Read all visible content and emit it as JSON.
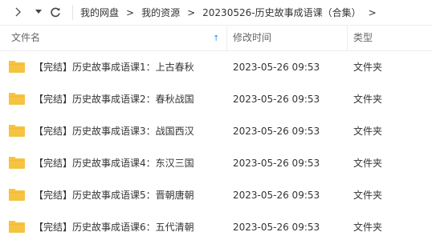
{
  "toolbar": {
    "back_icon": "chevron-right-icon",
    "dropdown_icon": "caret-down-icon",
    "refresh_icon": "refresh-icon"
  },
  "breadcrumbs": [
    {
      "label": "我的网盘"
    },
    {
      "label": "我的资源"
    },
    {
      "label": "20230526-历史故事成语课（合集）"
    }
  ],
  "breadcrumb_separator": ">",
  "header": {
    "name": "文件名",
    "sort_indicator": "↑",
    "date": "修改时间",
    "type": "类型"
  },
  "colors": {
    "folder": "#f7c343",
    "folder_tab": "#f0b42a",
    "sort_accent": "#3a8ee6"
  },
  "files": [
    {
      "name": "【完结】历史故事成语课1：上古春秋",
      "date": "2023-05-26 09:53",
      "type": "文件夹"
    },
    {
      "name": "【完结】历史故事成语课2：春秋战国",
      "date": "2023-05-26 09:53",
      "type": "文件夹"
    },
    {
      "name": "【完结】历史故事成语课3：战国西汉",
      "date": "2023-05-26 09:53",
      "type": "文件夹"
    },
    {
      "name": "【完结】历史故事成语课4：东汉三国",
      "date": "2023-05-26 09:53",
      "type": "文件夹"
    },
    {
      "name": "【完结】历史故事成语课5：晋朝唐朝",
      "date": "2023-05-26 09:53",
      "type": "文件夹"
    },
    {
      "name": "【完结】历史故事成语课6：五代清朝",
      "date": "2023-05-26 09:53",
      "type": "文件夹"
    }
  ]
}
